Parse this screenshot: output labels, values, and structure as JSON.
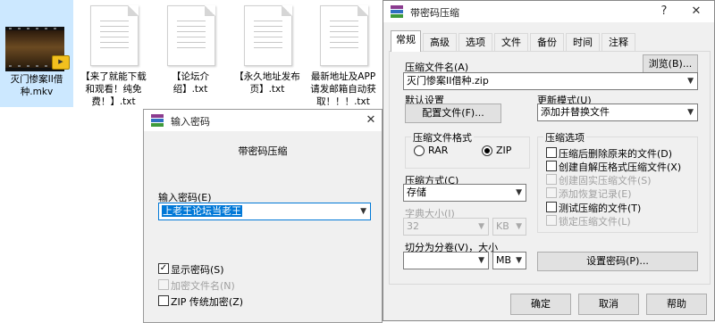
{
  "desktop": {
    "files": [
      {
        "label": "灭门惨案II借种.mkv",
        "kind": "video"
      },
      {
        "label": "【来了就能下载和观看！纯免费！】.txt",
        "kind": "text"
      },
      {
        "label": "【论坛介绍】.txt",
        "kind": "text"
      },
      {
        "label": "【永久地址发布页】.txt",
        "kind": "text"
      },
      {
        "label": "最新地址及APP请发邮箱自动获取！！！.txt",
        "kind": "text"
      }
    ]
  },
  "archive_dialog": {
    "title": "带密码压缩",
    "help_btn": "?",
    "close_btn": "✕",
    "tabs": [
      "常规",
      "高级",
      "选项",
      "文件",
      "备份",
      "时间",
      "注释"
    ],
    "archive_name_label": "压缩文件名(A)",
    "browse_btn": "浏览(B)...",
    "archive_name_value": "灭门惨案II借种.zip",
    "default_settings_label": "默认设置",
    "profiles_btn": "配置文件(F)...",
    "update_mode_label": "更新模式(U)",
    "update_mode_value": "添加并替换文件",
    "format_group": "压缩文件格式",
    "format_rar": "RAR",
    "format_zip": "ZIP",
    "selected_format": "ZIP",
    "method_label": "压缩方式(C)",
    "method_value": "存储",
    "dict_label": "字典大小(I)",
    "dict_value": "32",
    "dict_unit": "KB",
    "split_label": "切分为分卷(V)，大小",
    "split_value": "",
    "split_unit": "MB",
    "options_group": "压缩选项",
    "options": [
      {
        "label": "压缩后删除原来的文件(D)",
        "checked": false,
        "disabled": false
      },
      {
        "label": "创建自解压格式压缩文件(X)",
        "checked": false,
        "disabled": false
      },
      {
        "label": "创建固实压缩文件(S)",
        "checked": false,
        "disabled": true
      },
      {
        "label": "添加恢复记录(E)",
        "checked": false,
        "disabled": true
      },
      {
        "label": "测试压缩的文件(T)",
        "checked": false,
        "disabled": false
      },
      {
        "label": "锁定压缩文件(L)",
        "checked": false,
        "disabled": true
      }
    ],
    "set_password_btn": "设置密码(P)...",
    "ok_btn": "确定",
    "cancel_btn": "取消",
    "help_button": "帮助"
  },
  "password_dialog": {
    "title": "输入密码",
    "close_btn": "✕",
    "heading": "带密码压缩",
    "password_label": "输入密码(E)",
    "password_value": "上老王论坛当老王",
    "options": [
      {
        "label": "显示密码(S)",
        "checked": true,
        "disabled": false
      },
      {
        "label": "加密文件名(N)",
        "checked": false,
        "disabled": true
      },
      {
        "label": "ZIP 传统加密(Z)",
        "checked": false,
        "disabled": false
      }
    ]
  },
  "colors": {
    "selection": "#cce8ff",
    "dialog_bg": "#f0f0f0",
    "highlight": "#0078d7"
  }
}
